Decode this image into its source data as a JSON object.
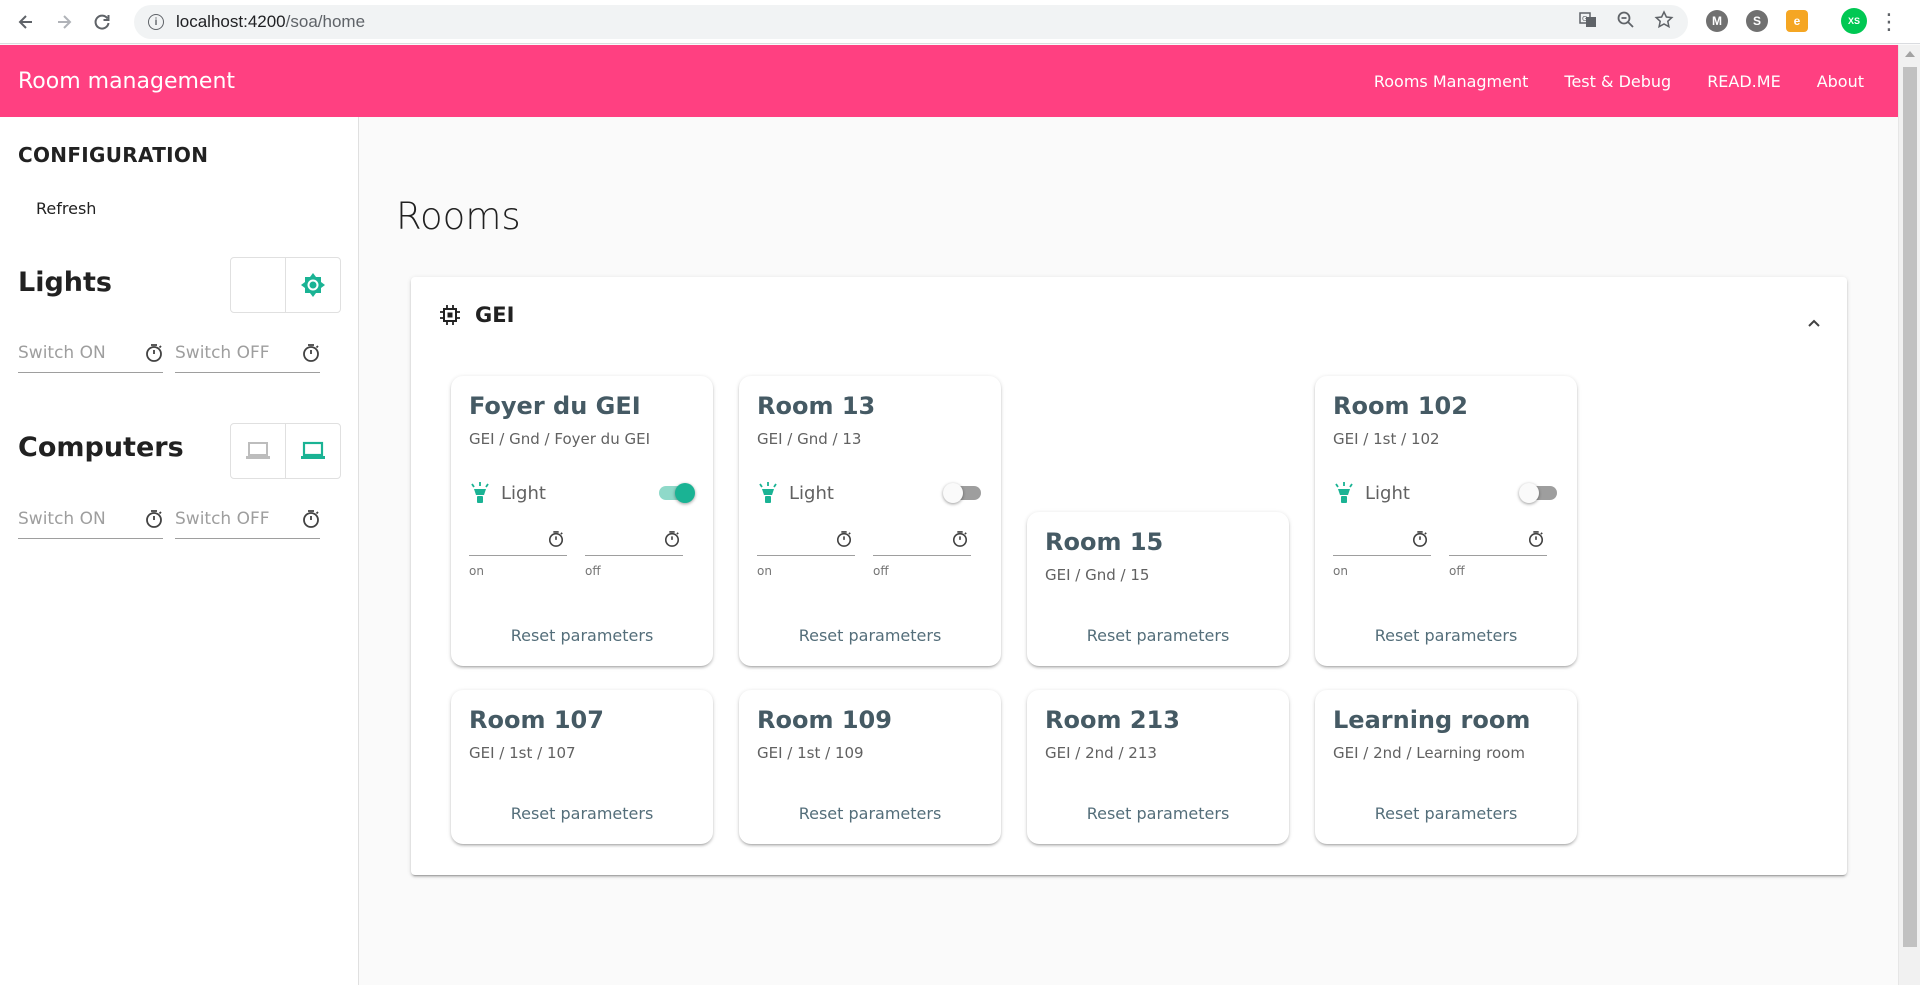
{
  "browser": {
    "url_host": "localhost:4200",
    "url_path": "/soa/home",
    "profile_initials": "XS"
  },
  "toolbar": {
    "title": "Room management",
    "links": [
      "Rooms Managment",
      "Test & Debug",
      "READ.ME",
      "About"
    ]
  },
  "sidebar": {
    "config_title": "CONFIGURATION",
    "refresh_label": "Refresh",
    "lights": {
      "title": "Lights",
      "switch_on_placeholder": "Switch ON",
      "switch_off_placeholder": "Switch OFF"
    },
    "computers": {
      "title": "Computers",
      "switch_on_placeholder": "Switch ON",
      "switch_off_placeholder": "Switch OFF"
    }
  },
  "main": {
    "title": "Rooms",
    "building": "GEI",
    "rooms": [
      {
        "name": "Foyer du GEI",
        "path": "GEI / Gnd / Foyer du GEI",
        "light_label": "Light",
        "light_on": true,
        "on_label": "on",
        "off_label": "off",
        "reset_label": "Reset parameters"
      },
      {
        "name": "Room 13",
        "path": "GEI / Gnd / 13",
        "light_label": "Light",
        "light_on": false,
        "on_label": "on",
        "off_label": "off",
        "reset_label": "Reset parameters"
      },
      {
        "name": "Room 15",
        "path": "GEI / Gnd / 15",
        "reset_label": "Reset parameters"
      },
      {
        "name": "Room 102",
        "path": "GEI / 1st / 102",
        "light_label": "Light",
        "light_on": false,
        "on_label": "on",
        "off_label": "off",
        "reset_label": "Reset parameters"
      },
      {
        "name": "Room 107",
        "path": "GEI / 1st / 107",
        "reset_label": "Reset parameters"
      },
      {
        "name": "Room 109",
        "path": "GEI / 1st / 109",
        "reset_label": "Reset parameters"
      },
      {
        "name": "Room 213",
        "path": "GEI / 2nd / 213",
        "reset_label": "Reset parameters"
      },
      {
        "name": "Learning room",
        "path": "GEI / 2nd / Learning room",
        "reset_label": "Reset parameters"
      }
    ]
  },
  "colors": {
    "primary": "#ff4081",
    "accent": "#1ab394",
    "title_text": "#455a64"
  }
}
